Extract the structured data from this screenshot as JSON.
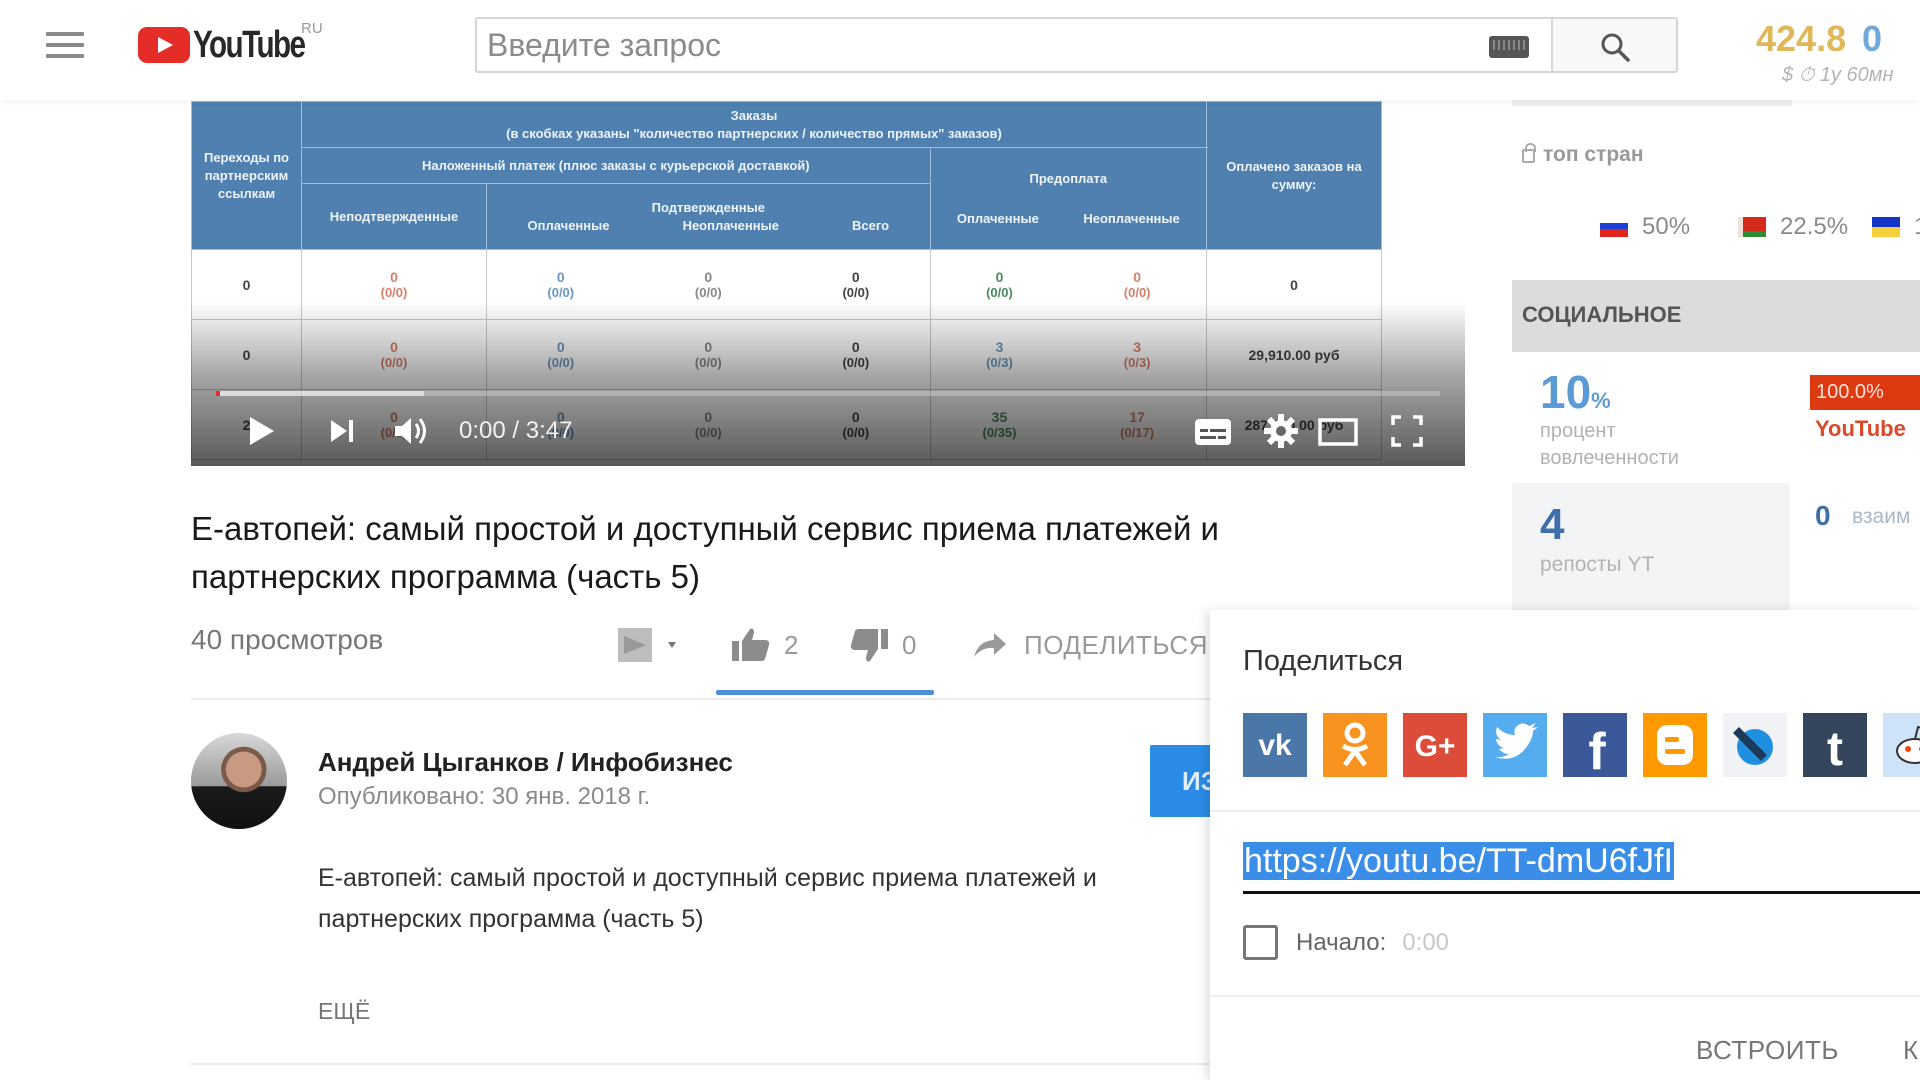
{
  "header": {
    "logo_text": "YouTube",
    "logo_region": "RU",
    "search_placeholder": "Введите запрос",
    "stats": {
      "money": "424.8",
      "zero": "0",
      "sub": "$ ⏱ 1у   60мн"
    }
  },
  "player": {
    "time": "0:00 / 3:47",
    "progress_played_fraction": 0.0,
    "progress_loaded_fraction": 0.17,
    "table": {
      "headers": {
        "clicks": "Переходы по партнерским ссылкам",
        "orders_title": "Заказы",
        "orders_note": "(в скобках указаны \"количество партнерских / количество прямых\" заказов)",
        "cod": "Наложенный платеж (плюс заказы с курьерской доставкой)",
        "unconfirmed": "Неподтвержденные",
        "confirmed": "Подтвержденные",
        "paid": "Оплаченные",
        "unpaid": "Неоплаченные",
        "total": "Всего",
        "prepay": "Предоплата",
        "prepay_paid": "Оплаченные",
        "prepay_unpaid": "Неоплаченные",
        "paid_sum": "Оплачено заказов на сумму:"
      },
      "rows": [
        {
          "clicks": "0",
          "unconfirmed": [
            "0",
            "(0/0)"
          ],
          "paid": [
            "0",
            "(0/0)"
          ],
          "unpaid": [
            "0",
            "(0/0)"
          ],
          "total": [
            "0",
            "(0/0)"
          ],
          "pre_paid": [
            "0",
            "(0/0)"
          ],
          "pre_unpaid": [
            "0",
            "(0/0)"
          ],
          "sum": "0"
        },
        {
          "clicks": "0",
          "unconfirmed": [
            "0",
            "(0/0)"
          ],
          "paid": [
            "0",
            "(0/0)"
          ],
          "unpaid": [
            "0",
            "(0/0)"
          ],
          "total": [
            "0",
            "(0/0)"
          ],
          "pre_paid": [
            "3",
            "(0/3)"
          ],
          "pre_unpaid": [
            "3",
            "(0/3)"
          ],
          "sum": "29,910.00 руб"
        },
        {
          "clicks": "2",
          "unconfirmed": [
            "0",
            "(0/0)"
          ],
          "paid": [
            "0",
            "(0/0)"
          ],
          "unpaid": [
            "0",
            "(0/0)"
          ],
          "total": [
            "0",
            "(0/0)"
          ],
          "pre_paid": [
            "35",
            "(0/35)"
          ],
          "pre_unpaid": [
            "17",
            "(0/17)"
          ],
          "sum": "287,260.00 руб"
        }
      ]
    }
  },
  "video": {
    "title": "Е-автопей: самый простой и доступный сервис приема платежей и партнерских программа (часть 5)",
    "views": "40 просмотров",
    "likes": "2",
    "dislikes": "0",
    "share_label": "ПОДЕЛИТЬСЯ"
  },
  "channel": {
    "name": "Андрей Цыганков / Инфобизнес",
    "published": "Опубликовано: 30 янв. 2018 г.",
    "subscribe_label": "ИЗ",
    "description": "Е-автопей: самый простой и доступный сервис приема платежей и партнерских программа (часть 5)",
    "more_label": "ЕЩЁ"
  },
  "right_panel": {
    "top_countries_label": "топ стран",
    "countries": [
      {
        "name": "Russia",
        "value": "50%",
        "icon": "flag-ru-icon"
      },
      {
        "name": "Belarus",
        "value": "22.5%",
        "icon": "flag-by-icon"
      },
      {
        "name": "Ukraine",
        "value": "1",
        "icon": "flag-ua-icon"
      }
    ],
    "social_title": "СОЦИАЛЬНОЕ",
    "engagement_value": "10",
    "engagement_unit": "%",
    "engagement_label_1": "процент",
    "engagement_label_2": "вовлеченности",
    "youtube_share_value": "100.0%",
    "youtube_share_fraction": 1.0,
    "youtube_share_label": "YouTube",
    "reposts_value": "4",
    "reposts_label": "репосты YT",
    "interactions_value": "0",
    "interactions_label": "взаим"
  },
  "share_panel": {
    "title": "Поделиться",
    "networks": [
      {
        "name": "vk",
        "glyph": "vk",
        "color": "#4a76a8"
      },
      {
        "name": "odnoklassniki",
        "glyph": "ok",
        "color": "#f7931e"
      },
      {
        "name": "google-plus",
        "glyph": "G+",
        "color": "#dd4b39"
      },
      {
        "name": "twitter",
        "glyph": "tw",
        "color": "#55acee"
      },
      {
        "name": "facebook",
        "glyph": "f",
        "color": "#3b5998"
      },
      {
        "name": "blogger",
        "glyph": "B",
        "color": "#ff9900"
      },
      {
        "name": "livejournal",
        "glyph": "lj",
        "color": "#f0f2f5"
      },
      {
        "name": "tumblr",
        "glyph": "t",
        "color": "#35465c"
      },
      {
        "name": "reddit",
        "glyph": "r",
        "color": "#cee3f8"
      }
    ],
    "url": "https://youtu.be/TT-dmU6fJfI",
    "start_label": "Начало:",
    "start_time": "0:00",
    "start_checked": false,
    "embed_label": "ВСТРОИТЬ",
    "copy_label": "К"
  }
}
